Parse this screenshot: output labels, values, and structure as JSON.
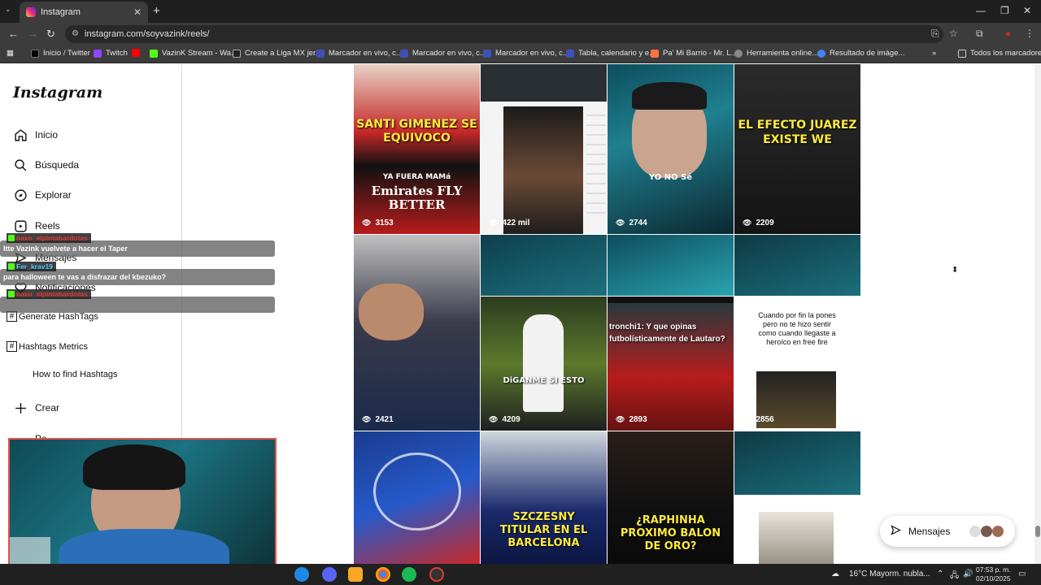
{
  "browser": {
    "tab_title": "Instagram",
    "url": "instagram.com/soyvazink/reels/",
    "bookmarks": [
      "Inicio / Twitter",
      "Twitch",
      "",
      "VazinK Stream - Wa...",
      "Create a Liga MX jer...",
      "Marcador en vivo, c...",
      "Marcador en vivo, c...",
      "Marcador en vivo, c...",
      "Tabla, calendario y e...",
      "Pa' Mi Barrio - Mr. L...",
      "Herramienta online...",
      "Resultado de imáge..."
    ],
    "all_bookmarks": "Todos los marcadores"
  },
  "sidebar": {
    "logo": "Instagram",
    "items": [
      {
        "label": "Inicio",
        "icon": "home-icon"
      },
      {
        "label": "Búsqueda",
        "icon": "search-icon"
      },
      {
        "label": "Explorar",
        "icon": "compass-icon"
      },
      {
        "label": "Reels",
        "icon": "reels-icon"
      },
      {
        "label": "Mensajes",
        "icon": "messenger-icon"
      },
      {
        "label": "Notificaciones",
        "icon": "heart-icon"
      }
    ],
    "extensions": [
      "Generate HashTags",
      "Hashtags Metrics",
      "How to find Hashtags"
    ],
    "create": "Crear",
    "partial": "Pe..."
  },
  "chat_overlay": [
    {
      "user": "naxo_elpintabardotas",
      "user_color": "#e53935",
      "message": "Itte Vazink vuelvete a hacer el Taper"
    },
    {
      "user": "Fer_krav19",
      "user_color": "#4fc3f7",
      "message": "para halloween te vas a disfrazar del kbezuko?"
    },
    {
      "user": "naxo_elpintabardotas",
      "user_color": "#e53935",
      "message": ""
    }
  ],
  "reels": [
    {
      "caption": "SANTI GIMENEZ SE EQUIVOCO",
      "sub": "YA FUERA MAMá",
      "extra": "Emirates FLY BETTER",
      "views": "3153"
    },
    {
      "caption": "",
      "views": "422 mil"
    },
    {
      "caption": "YO NO Sé",
      "views": "2744"
    },
    {
      "caption": "EL EFECTO JUAREZ EXISTE WE",
      "views": "2209"
    },
    {
      "caption": "",
      "views": "2421"
    },
    {
      "caption": "DiGANME SI ESTO",
      "views": "4209"
    },
    {
      "caption": "tronchi1: Y que opinas futbolísticamente de Lautaro?",
      "views": "2893"
    },
    {
      "caption": "Cuando por fin la pones pero no te hizo sentir como cuando llegaste a heroíco en free fire",
      "views": "2856"
    },
    {
      "caption": "",
      "views": ""
    },
    {
      "caption": "SZCZESNY TITULAR EN EL BARCELONA",
      "views": ""
    },
    {
      "caption": "¿RAPHINHA PROXIMO BALON DE ORO?",
      "views": ""
    },
    {
      "caption": "",
      "views": ""
    }
  ],
  "messages_button": "Mensajes",
  "taskbar": {
    "weather": "16°C  Mayorm. nubla...",
    "time": "07:53 p. m.",
    "date": "02/10/2025"
  }
}
